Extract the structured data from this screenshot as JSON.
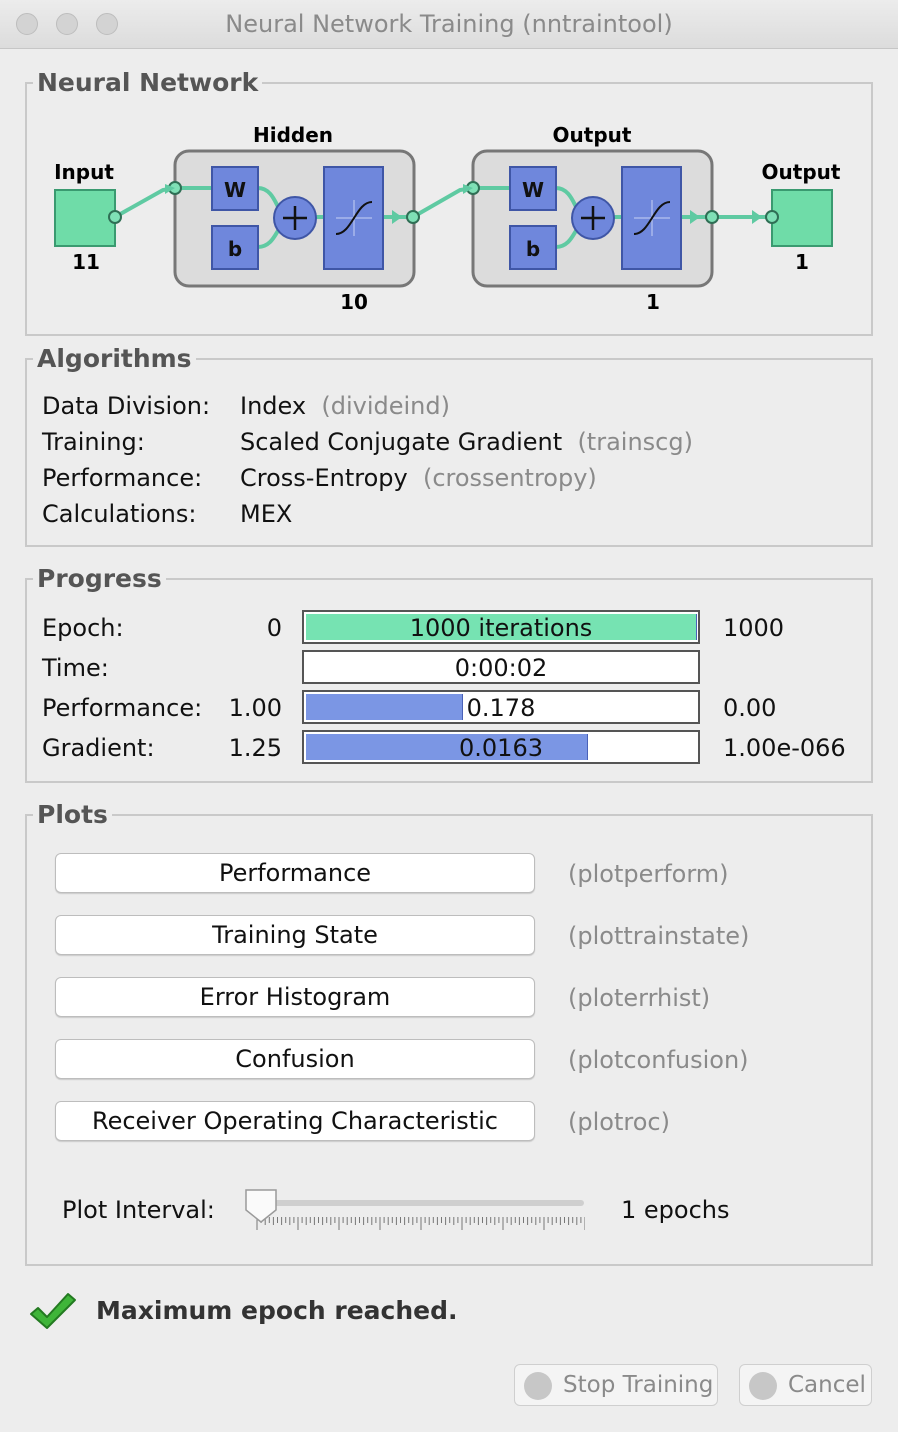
{
  "window": {
    "title": "Neural Network Training (nntraintool)"
  },
  "network": {
    "legend": "Neural Network",
    "input_label": "Input",
    "input_size": "11",
    "hidden_label": "Hidden",
    "hidden_size": "10",
    "output_layer_label": "Output",
    "output_layer_size": "1",
    "output_label": "Output",
    "output_size": "1",
    "weight_symbol": "W",
    "bias_symbol": "b"
  },
  "algorithms": {
    "legend": "Algorithms",
    "rows": [
      {
        "label": "Data Division:",
        "value": "Index",
        "fn": "(divideind)"
      },
      {
        "label": "Training:",
        "value": "Scaled Conjugate Gradient",
        "fn": "(trainscg)"
      },
      {
        "label": "Performance:",
        "value": "Cross-Entropy",
        "fn": "(crossentropy)"
      },
      {
        "label": "Calculations:",
        "value": "MEX",
        "fn": ""
      }
    ]
  },
  "progress": {
    "legend": "Progress",
    "rows": [
      {
        "label": "Epoch:",
        "start": "0",
        "bar_text": "1000 iterations",
        "end": "1000",
        "fill": 1.0,
        "color": "#76e3b2"
      },
      {
        "label": "Time:",
        "start": "",
        "bar_text": "0:00:02",
        "end": "",
        "fill": 0.0,
        "color": "#ffffff"
      },
      {
        "label": "Performance:",
        "start": "1.00",
        "bar_text": "0.178",
        "end": "0.00",
        "fill": 0.4,
        "color": "#7b96e4"
      },
      {
        "label": "Gradient:",
        "start": "1.25",
        "bar_text": "0.0163",
        "end": "1.00e-066",
        "fill": 0.72,
        "color": "#7b96e4"
      }
    ]
  },
  "plots": {
    "legend": "Plots",
    "buttons": [
      {
        "label": "Performance",
        "fn": "(plotperform)"
      },
      {
        "label": "Training State",
        "fn": "(plottrainstate)"
      },
      {
        "label": "Error Histogram",
        "fn": "(ploterrhist)"
      },
      {
        "label": "Confusion",
        "fn": "(plotconfusion)"
      },
      {
        "label": "Receiver Operating Characteristic",
        "fn": "(plotroc)"
      }
    ],
    "interval_label": "Plot Interval:",
    "interval_value": "1 epochs",
    "interval_level": 0.0
  },
  "status": {
    "message": "Maximum epoch reached."
  },
  "footer": {
    "stop_label": "Stop Training",
    "cancel_label": "Cancel"
  },
  "colors": {
    "input_output_box": "#6fdca8",
    "layer_block": "#6f87dc",
    "connector": "#5fcaa2"
  }
}
